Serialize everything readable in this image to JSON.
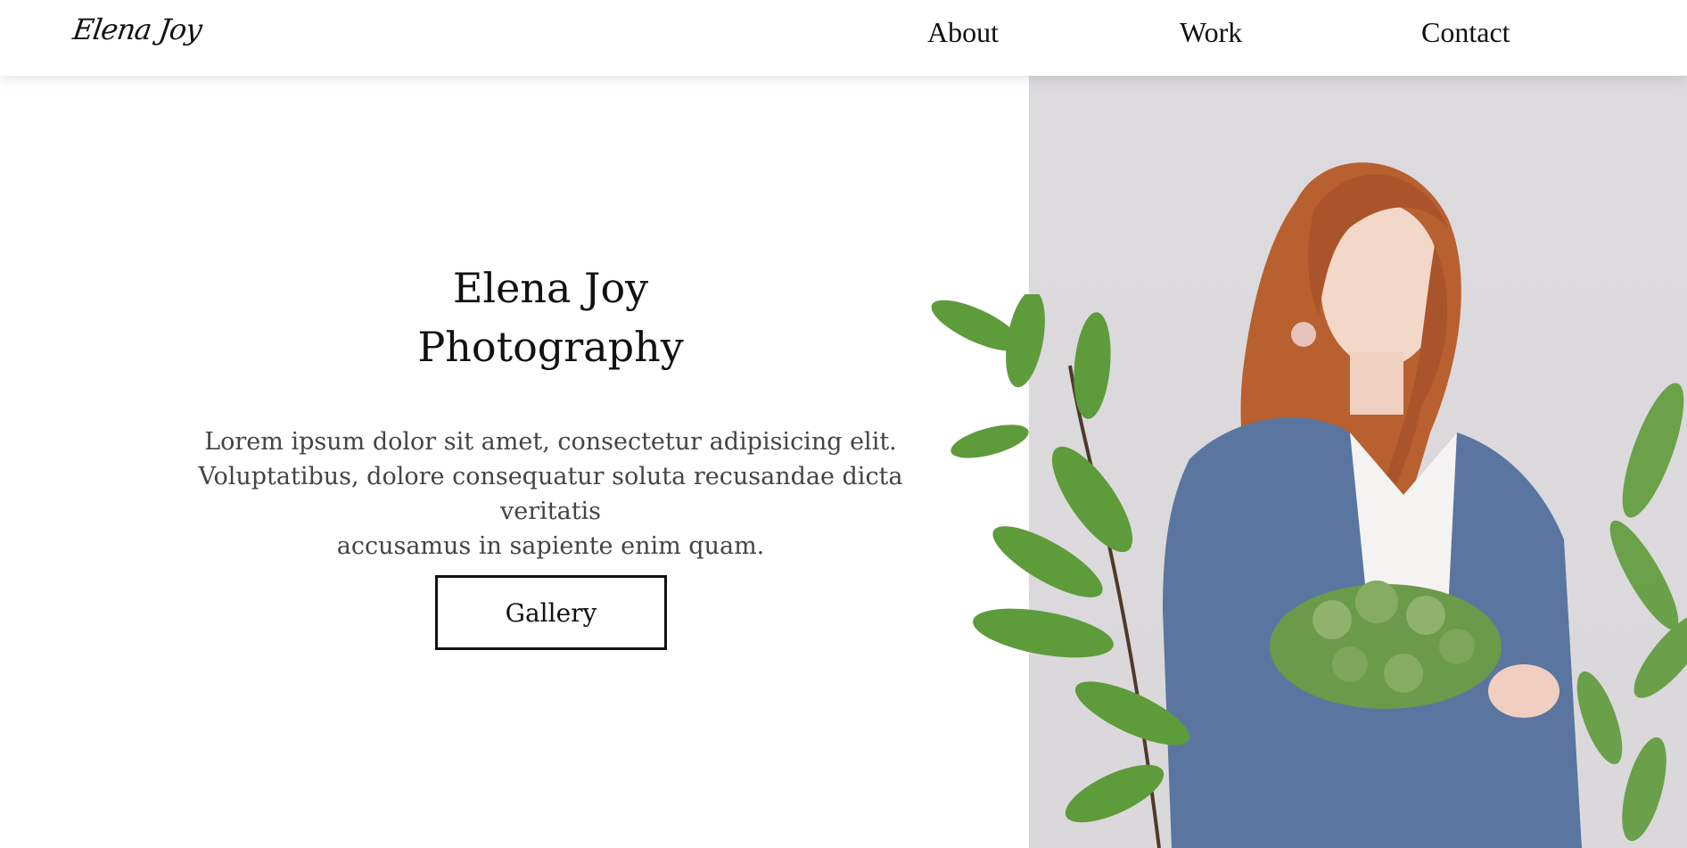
{
  "header": {
    "logo": "Elena Joy",
    "nav": [
      "About",
      "Work",
      "Contact"
    ]
  },
  "hero": {
    "title_line1": "Elena Joy",
    "title_line2": "Photography",
    "description_line1": "Lorem ipsum dolor sit amet, consectetur adipisicing elit.",
    "description_line2": "Voluptatibus, dolore consequatur soluta recusandae dicta veritatis",
    "description_line3": "accusamus in sapiente enim quam.",
    "button_label": "Gallery"
  },
  "colors": {
    "background": "#ffffff",
    "text": "#111111",
    "muted_text": "#444444",
    "photo_bg": "#dcdadd",
    "hair": "#b8602f",
    "cardigan": "#5a76a0",
    "leaf": "#5e9b3a"
  }
}
